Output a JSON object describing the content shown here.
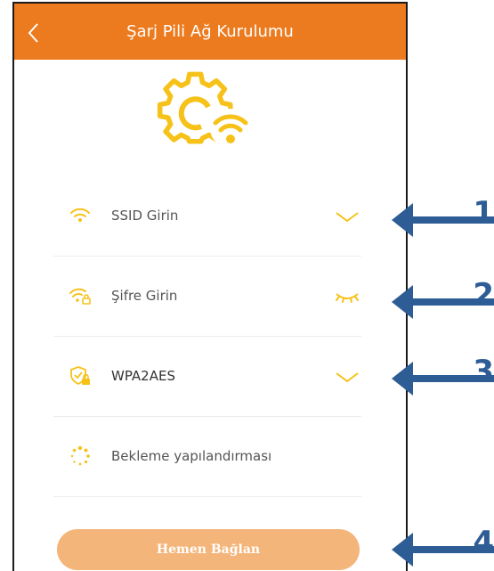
{
  "header": {
    "title": "Şarj Pili Ağ Kurulumu",
    "back_icon": "chevron-left-icon"
  },
  "hero": {
    "icon": "gear-wifi-icon"
  },
  "form": {
    "ssid": {
      "placeholder": "SSID Girin",
      "icon": "wifi-icon",
      "action_icon": "chevron-down-icon"
    },
    "password": {
      "placeholder": "Şifre Girin",
      "icon": "wifi-lock-icon",
      "action_icon": "eye-closed-icon"
    },
    "security": {
      "value": "WPA2AES",
      "icon": "shield-lock-icon",
      "action_icon": "chevron-down-icon"
    },
    "standby": {
      "label": "Bekleme yapılandırması",
      "icon": "loading-dots-icon"
    }
  },
  "connect_button": {
    "label": "Hemen Bağlan"
  },
  "callouts": [
    {
      "number": "1"
    },
    {
      "number": "2"
    },
    {
      "number": "3"
    },
    {
      "number": "4"
    }
  ],
  "colors": {
    "accent": "#ec7a1e",
    "icon": "#f6c21a",
    "button": "#f4b57a",
    "callout": "#2e5d96"
  }
}
